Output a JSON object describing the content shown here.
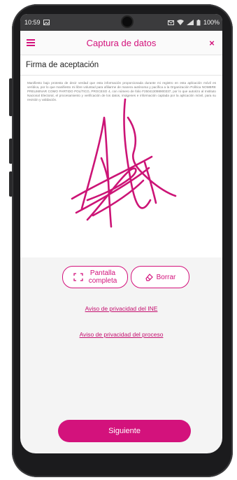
{
  "status_bar": {
    "time": "10:59",
    "battery": "100%",
    "icons": [
      "image-icon",
      "mail-icon",
      "wifi-icon",
      "signal-icon",
      "battery-icon"
    ]
  },
  "header": {
    "title": "Captura de datos",
    "menu_icon": "menu-icon",
    "close_symbol": "×"
  },
  "section": {
    "title": "Firma de aceptación"
  },
  "legal_text": "Manifiesto bajo protesta de decir verdad que esta información proporcionada durante mi registro en esta aplicación móvil es verídica, por lo que manifiesto mi libre voluntad para afiliarme de manera autónoma y pacífica a la Organización Política NOMBRE PRELIMINAR COMO PARTIDO POLÍTICO, PROCESO 4, con número de folio F250413098900337, por lo que autorizo al Instituto Nacional Electoral, el procesamiento y verificación de los datos, imágenes e información captada por la aplicación móvil, para su revisión y validación.",
  "actions": {
    "fullscreen_label_line1": "Pantalla",
    "fullscreen_label_line2": "completa",
    "erase_label": "Borrar"
  },
  "links": {
    "privacy_ine": "Aviso de privacidad del INE",
    "privacy_process": "Aviso de privacidad del proceso"
  },
  "footer": {
    "next_label": "Siguiente"
  },
  "colors": {
    "accent": "#d3127c",
    "status_bar": "#3b3b3d",
    "background": "#f4f4f4"
  }
}
